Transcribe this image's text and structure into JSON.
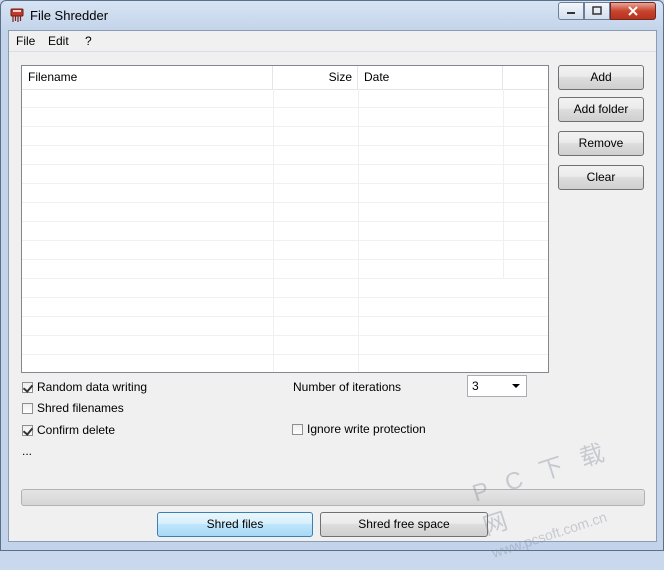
{
  "window": {
    "title": "File Shredder"
  },
  "menu": [
    "File",
    "Edit",
    "?"
  ],
  "list": {
    "columns": [
      "Filename",
      "Size",
      "Date"
    ],
    "row_count": 15
  },
  "side_buttons": {
    "add": "Add",
    "add_folder": "Add folder",
    "remove": "Remove",
    "clear": "Clear"
  },
  "options": {
    "random_data_writing": {
      "label": "Random data writing",
      "checked": true
    },
    "shred_filenames": {
      "label": "Shred filenames",
      "checked": false
    },
    "confirm_delete": {
      "label": "Confirm delete",
      "checked": true
    },
    "ignore_write_protection": {
      "label": "Ignore write protection",
      "checked": false
    },
    "iterations_label": "Number of iterations",
    "iterations_value": "3"
  },
  "status_text": "...",
  "progress": 0,
  "bottom_buttons": {
    "shred_files": "Shred files",
    "shred_free_space": "Shred free space"
  },
  "watermark": {
    "line1": "P C 下 载 网",
    "line2": "www.pcsoft.com.cn"
  }
}
